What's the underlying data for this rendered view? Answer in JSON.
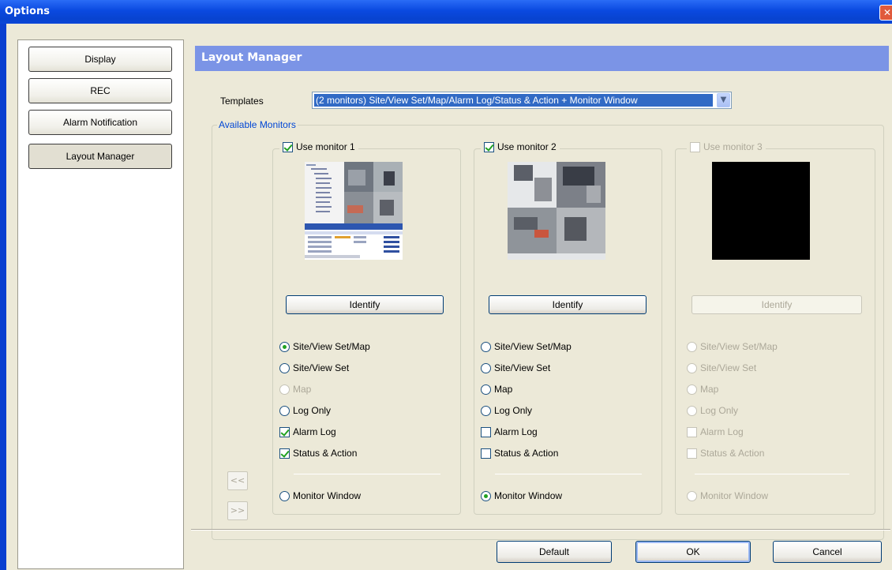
{
  "window": {
    "title": "Options",
    "close_symbol": "✕"
  },
  "sidebar": {
    "items": [
      {
        "label": "Display"
      },
      {
        "label": "REC"
      },
      {
        "label": "Alarm Notification"
      },
      {
        "label": "Layout Manager",
        "selected": true
      }
    ]
  },
  "main": {
    "header": "Layout Manager",
    "templates_label": "Templates",
    "templates_value": "(2 monitors) Site/View Set/Map/Alarm Log/Status & Action + Monitor Window",
    "group_label": "Available Monitors"
  },
  "monitors": [
    {
      "label": "Use monitor 1",
      "enabled": true,
      "checked": true,
      "identify_label": "Identify",
      "options": {
        "site_view_set_map": "Site/View Set/Map",
        "site_view_set": "Site/View Set",
        "map": "Map",
        "log_only": "Log Only",
        "alarm_log": "Alarm Log",
        "status_action": "Status & Action",
        "monitor_window": "Monitor Window"
      },
      "selected_view": "site_view_set_map",
      "alarm_log_checked": true,
      "status_action_checked": true,
      "monitor_window_selected": false
    },
    {
      "label": "Use monitor 2",
      "enabled": true,
      "checked": true,
      "identify_label": "Identify",
      "options": {
        "site_view_set_map": "Site/View Set/Map",
        "site_view_set": "Site/View Set",
        "map": "Map",
        "log_only": "Log Only",
        "alarm_log": "Alarm Log",
        "status_action": "Status & Action",
        "monitor_window": "Monitor Window"
      },
      "selected_view": "none",
      "alarm_log_checked": false,
      "status_action_checked": false,
      "monitor_window_selected": true
    },
    {
      "label": "Use monitor 3",
      "enabled": false,
      "checked": false,
      "identify_label": "Identify",
      "options": {
        "site_view_set_map": "Site/View Set/Map",
        "site_view_set": "Site/View Set",
        "map": "Map",
        "log_only": "Log Only",
        "alarm_log": "Alarm Log",
        "status_action": "Status & Action",
        "monitor_window": "Monitor Window"
      },
      "selected_view": "none",
      "alarm_log_checked": false,
      "status_action_checked": false,
      "monitor_window_selected": false
    }
  ],
  "arrows": {
    "left": "<<",
    "right": ">>"
  },
  "footer": {
    "default_label": "Default",
    "ok_label": "OK",
    "cancel_label": "Cancel"
  }
}
